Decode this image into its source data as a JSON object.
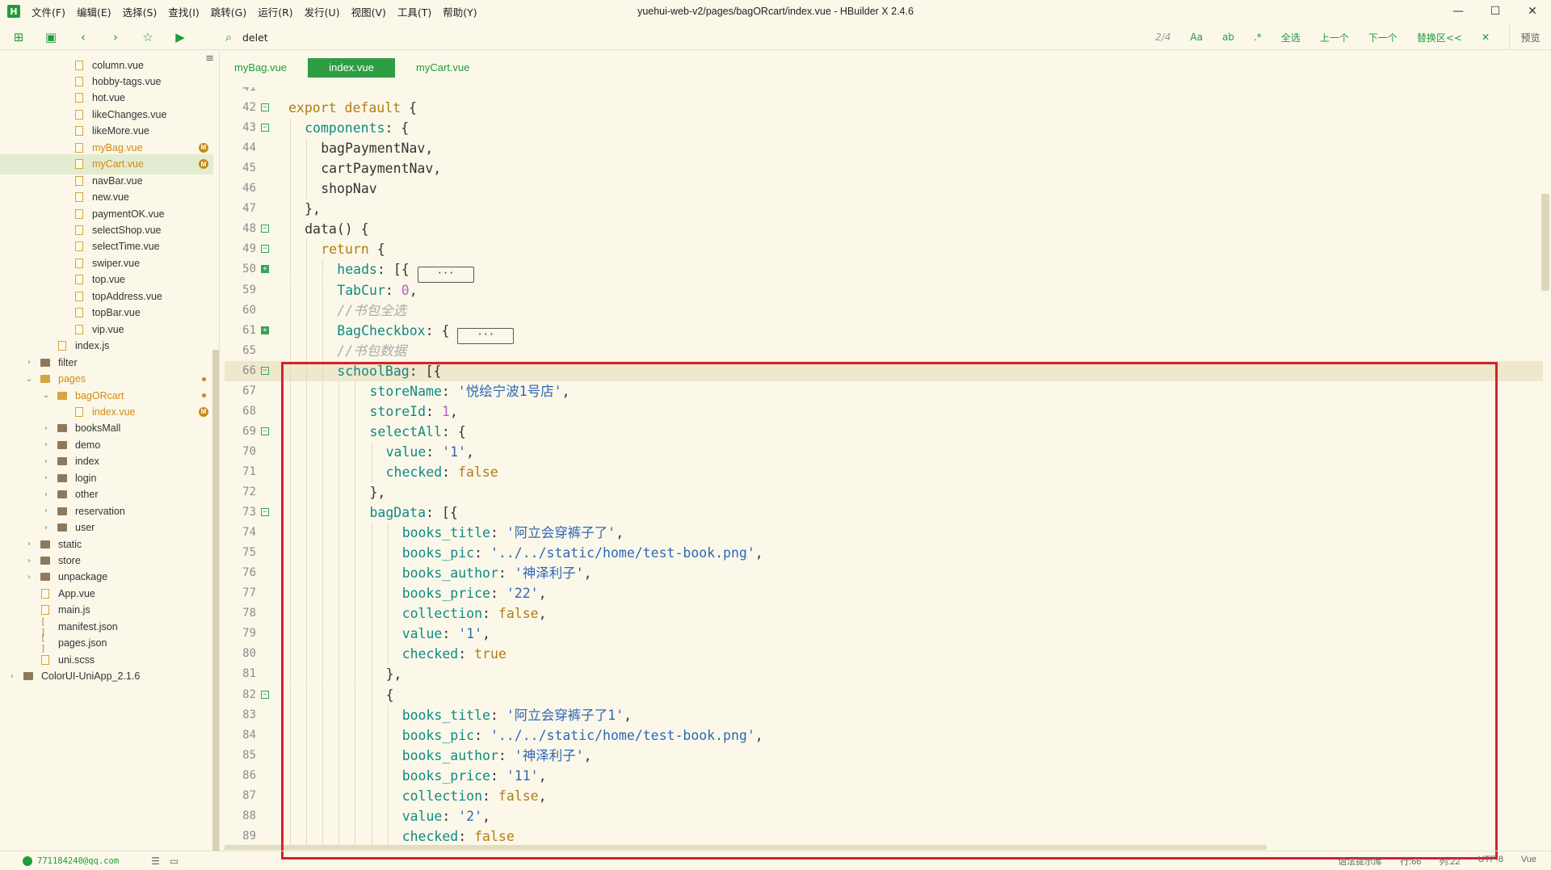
{
  "titlebar": {
    "logo": "H",
    "title": "yuehui-web-v2/pages/bagORcart/index.vue - HBuilder X 2.4.6",
    "menu": [
      "文件(F)",
      "编辑(E)",
      "选择(S)",
      "查找(I)",
      "跳转(G)",
      "运行(R)",
      "发行(U)",
      "视图(V)",
      "工具(T)",
      "帮助(Y)"
    ],
    "controls": {
      "minimize": "—",
      "maximize": "☐",
      "close": "✕"
    }
  },
  "toolbar": {
    "search_value": "delet",
    "match_count": "2/4",
    "find_options": [
      "Aa",
      "ab",
      ".*"
    ],
    "select_all": "全选",
    "prev": "上一个",
    "next": "下一个",
    "replace": "替换区<<",
    "close": "✕",
    "preview": "预览"
  },
  "sidebar": {
    "items": [
      {
        "name": "column.vue",
        "depth": 4,
        "kind": "file"
      },
      {
        "name": "hobby-tags.vue",
        "depth": 4,
        "kind": "file"
      },
      {
        "name": "hot.vue",
        "depth": 4,
        "kind": "file"
      },
      {
        "name": "likeChanges.vue",
        "depth": 4,
        "kind": "file"
      },
      {
        "name": "likeMore.vue",
        "depth": 4,
        "kind": "file"
      },
      {
        "name": "myBag.vue",
        "depth": 4,
        "kind": "file",
        "modified": true,
        "badge": "M"
      },
      {
        "name": "myCart.vue",
        "depth": 4,
        "kind": "file",
        "modified": true,
        "badge": "M",
        "selected": true
      },
      {
        "name": "navBar.vue",
        "depth": 4,
        "kind": "file"
      },
      {
        "name": "new.vue",
        "depth": 4,
        "kind": "file"
      },
      {
        "name": "paymentOK.vue",
        "depth": 4,
        "kind": "file"
      },
      {
        "name": "selectShop.vue",
        "depth": 4,
        "kind": "file"
      },
      {
        "name": "selectTime.vue",
        "depth": 4,
        "kind": "file"
      },
      {
        "name": "swiper.vue",
        "depth": 4,
        "kind": "file"
      },
      {
        "name": "top.vue",
        "depth": 4,
        "kind": "file"
      },
      {
        "name": "topAddress.vue",
        "depth": 4,
        "kind": "file"
      },
      {
        "name": "topBar.vue",
        "depth": 4,
        "kind": "file"
      },
      {
        "name": "vip.vue",
        "depth": 4,
        "kind": "file"
      },
      {
        "name": "index.js",
        "depth": 3,
        "kind": "file"
      },
      {
        "name": "filter",
        "depth": 2,
        "kind": "folder",
        "chev": "›"
      },
      {
        "name": "pages",
        "depth": 2,
        "kind": "folder-open",
        "chev": "⌄",
        "modified": true,
        "dot": true
      },
      {
        "name": "bagORcart",
        "depth": 3,
        "kind": "folder-open",
        "chev": "⌄",
        "modified": true,
        "dot": true
      },
      {
        "name": "index.vue",
        "depth": 4,
        "kind": "file",
        "modified": true,
        "badge": "M"
      },
      {
        "name": "booksMall",
        "depth": 3,
        "kind": "folder",
        "chev": "›"
      },
      {
        "name": "demo",
        "depth": 3,
        "kind": "folder",
        "chev": "›"
      },
      {
        "name": "index",
        "depth": 3,
        "kind": "folder",
        "chev": "›"
      },
      {
        "name": "login",
        "depth": 3,
        "kind": "folder",
        "chev": "›"
      },
      {
        "name": "other",
        "depth": 3,
        "kind": "folder",
        "chev": "›"
      },
      {
        "name": "reservation",
        "depth": 3,
        "kind": "folder",
        "chev": "›"
      },
      {
        "name": "user",
        "depth": 3,
        "kind": "folder",
        "chev": "›"
      },
      {
        "name": "static",
        "depth": 2,
        "kind": "folder",
        "chev": "›"
      },
      {
        "name": "store",
        "depth": 2,
        "kind": "folder",
        "chev": "›"
      },
      {
        "name": "unpackage",
        "depth": 2,
        "kind": "folder",
        "chev": "›"
      },
      {
        "name": "App.vue",
        "depth": 2,
        "kind": "file"
      },
      {
        "name": "main.js",
        "depth": 2,
        "kind": "file"
      },
      {
        "name": "manifest.json",
        "depth": 2,
        "kind": "json"
      },
      {
        "name": "pages.json",
        "depth": 2,
        "kind": "json"
      },
      {
        "name": "uni.scss",
        "depth": 2,
        "kind": "file"
      },
      {
        "name": "ColorUI-UniApp_2.1.6",
        "depth": 1,
        "kind": "folder",
        "chev": "›"
      }
    ]
  },
  "tabs": [
    {
      "label": "myBag.vue",
      "active": false
    },
    {
      "label": "index.vue",
      "active": true
    },
    {
      "label": "myCart.vue",
      "active": false
    }
  ],
  "editor": {
    "ellipsis": "···",
    "lines": [
      {
        "n": "41",
        "indent": 0,
        "tokens": []
      },
      {
        "n": "42",
        "indent": 0,
        "fold": "open",
        "tokens": [
          [
            "kw",
            "export default"
          ],
          [
            "plain",
            " {"
          ]
        ]
      },
      {
        "n": "43",
        "indent": 1,
        "fold": "open",
        "tokens": [
          [
            "prop",
            "components"
          ],
          [
            "plain",
            ": {"
          ]
        ]
      },
      {
        "n": "44",
        "indent": 2,
        "tokens": [
          [
            "plain",
            "bagPaymentNav,"
          ]
        ]
      },
      {
        "n": "45",
        "indent": 2,
        "tokens": [
          [
            "plain",
            "cartPaymentNav,"
          ]
        ]
      },
      {
        "n": "46",
        "indent": 2,
        "tokens": [
          [
            "plain",
            "shopNav"
          ]
        ]
      },
      {
        "n": "47",
        "indent": 1,
        "tokens": [
          [
            "plain",
            "},"
          ]
        ]
      },
      {
        "n": "48",
        "indent": 1,
        "fold": "open",
        "tokens": [
          [
            "plain",
            "data() {"
          ]
        ]
      },
      {
        "n": "49",
        "indent": 2,
        "fold": "open",
        "tokens": [
          [
            "kw",
            "return"
          ],
          [
            "plain",
            " {"
          ]
        ]
      },
      {
        "n": "50",
        "indent": 3,
        "fold": "collapsed",
        "tokens": [
          [
            "prop",
            "heads"
          ],
          [
            "plain",
            ": [{ "
          ],
          [
            "box",
            ""
          ]
        ]
      },
      {
        "n": "59",
        "indent": 3,
        "tokens": [
          [
            "prop",
            "TabCur"
          ],
          [
            "plain",
            ": "
          ],
          [
            "num",
            "0"
          ],
          [
            "plain",
            ","
          ]
        ]
      },
      {
        "n": "60",
        "indent": 3,
        "tokens": [
          [
            "cm",
            "//书包全选"
          ]
        ]
      },
      {
        "n": "61",
        "indent": 3,
        "fold": "collapsed",
        "tokens": [
          [
            "prop",
            "BagCheckbox"
          ],
          [
            "plain",
            ": { "
          ],
          [
            "box",
            ""
          ]
        ]
      },
      {
        "n": "65",
        "indent": 3,
        "tokens": [
          [
            "cm",
            "//书包数据"
          ]
        ]
      },
      {
        "n": "66",
        "indent": 3,
        "fold": "open",
        "current": true,
        "tokens": [
          [
            "prop",
            "schoolBag"
          ],
          [
            "plain",
            ": [{"
          ]
        ]
      },
      {
        "n": "67",
        "indent": 5,
        "tokens": [
          [
            "prop",
            "storeName"
          ],
          [
            "plain",
            ": "
          ],
          [
            "str",
            "'悦绘宁波1号店'"
          ],
          [
            "plain",
            ","
          ]
        ]
      },
      {
        "n": "68",
        "indent": 5,
        "tokens": [
          [
            "prop",
            "storeId"
          ],
          [
            "plain",
            ": "
          ],
          [
            "num",
            "1"
          ],
          [
            "plain",
            ","
          ]
        ]
      },
      {
        "n": "69",
        "indent": 5,
        "fold": "open",
        "tokens": [
          [
            "prop",
            "selectAll"
          ],
          [
            "plain",
            ": {"
          ]
        ]
      },
      {
        "n": "70",
        "indent": 6,
        "tokens": [
          [
            "prop",
            "value"
          ],
          [
            "plain",
            ": "
          ],
          [
            "str",
            "'1'"
          ],
          [
            "plain",
            ","
          ]
        ]
      },
      {
        "n": "71",
        "indent": 6,
        "tokens": [
          [
            "prop",
            "checked"
          ],
          [
            "plain",
            ": "
          ],
          [
            "bool",
            "false"
          ]
        ]
      },
      {
        "n": "72",
        "indent": 5,
        "tokens": [
          [
            "plain",
            "},"
          ]
        ]
      },
      {
        "n": "73",
        "indent": 5,
        "fold": "open",
        "tokens": [
          [
            "prop",
            "bagData"
          ],
          [
            "plain",
            ": [{"
          ]
        ]
      },
      {
        "n": "74",
        "indent": 7,
        "tokens": [
          [
            "prop",
            "books_title"
          ],
          [
            "plain",
            ": "
          ],
          [
            "str",
            "'阿立会穿裤子了'"
          ],
          [
            "plain",
            ","
          ]
        ]
      },
      {
        "n": "75",
        "indent": 7,
        "tokens": [
          [
            "prop",
            "books_pic"
          ],
          [
            "plain",
            ": "
          ],
          [
            "str",
            "'../../static/home/test-book.png'"
          ],
          [
            "plain",
            ","
          ]
        ]
      },
      {
        "n": "76",
        "indent": 7,
        "tokens": [
          [
            "prop",
            "books_author"
          ],
          [
            "plain",
            ": "
          ],
          [
            "str",
            "'神泽利子'"
          ],
          [
            "plain",
            ","
          ]
        ]
      },
      {
        "n": "77",
        "indent": 7,
        "tokens": [
          [
            "prop",
            "books_price"
          ],
          [
            "plain",
            ": "
          ],
          [
            "str",
            "'22'"
          ],
          [
            "plain",
            ","
          ]
        ]
      },
      {
        "n": "78",
        "indent": 7,
        "tokens": [
          [
            "prop",
            "collection"
          ],
          [
            "plain",
            ": "
          ],
          [
            "bool",
            "false"
          ],
          [
            "plain",
            ","
          ]
        ]
      },
      {
        "n": "79",
        "indent": 7,
        "tokens": [
          [
            "prop",
            "value"
          ],
          [
            "plain",
            ": "
          ],
          [
            "str",
            "'1'"
          ],
          [
            "plain",
            ","
          ]
        ]
      },
      {
        "n": "80",
        "indent": 7,
        "tokens": [
          [
            "prop",
            "checked"
          ],
          [
            "plain",
            ": "
          ],
          [
            "bool",
            "true"
          ]
        ]
      },
      {
        "n": "81",
        "indent": 6,
        "tokens": [
          [
            "plain",
            "},"
          ]
        ]
      },
      {
        "n": "82",
        "indent": 6,
        "fold": "open",
        "tokens": [
          [
            "plain",
            "{"
          ]
        ]
      },
      {
        "n": "83",
        "indent": 7,
        "tokens": [
          [
            "prop",
            "books_title"
          ],
          [
            "plain",
            ": "
          ],
          [
            "str",
            "'阿立会穿裤子了1'"
          ],
          [
            "plain",
            ","
          ]
        ]
      },
      {
        "n": "84",
        "indent": 7,
        "tokens": [
          [
            "prop",
            "books_pic"
          ],
          [
            "plain",
            ": "
          ],
          [
            "str",
            "'../../static/home/test-book.png'"
          ],
          [
            "plain",
            ","
          ]
        ]
      },
      {
        "n": "85",
        "indent": 7,
        "tokens": [
          [
            "prop",
            "books_author"
          ],
          [
            "plain",
            ": "
          ],
          [
            "str",
            "'神泽利子'"
          ],
          [
            "plain",
            ","
          ]
        ]
      },
      {
        "n": "86",
        "indent": 7,
        "tokens": [
          [
            "prop",
            "books_price"
          ],
          [
            "plain",
            ": "
          ],
          [
            "str",
            "'11'"
          ],
          [
            "plain",
            ","
          ]
        ]
      },
      {
        "n": "87",
        "indent": 7,
        "tokens": [
          [
            "prop",
            "collection"
          ],
          [
            "plain",
            ": "
          ],
          [
            "bool",
            "false"
          ],
          [
            "plain",
            ","
          ]
        ]
      },
      {
        "n": "88",
        "indent": 7,
        "tokens": [
          [
            "prop",
            "value"
          ],
          [
            "plain",
            ": "
          ],
          [
            "str",
            "'2'"
          ],
          [
            "plain",
            ","
          ]
        ]
      },
      {
        "n": "89",
        "indent": 7,
        "tokens": [
          [
            "prop",
            "checked"
          ],
          [
            "plain",
            ": "
          ],
          [
            "bool",
            "false"
          ]
        ]
      }
    ]
  },
  "statusbar": {
    "email": "771184240@qq.com",
    "right": [
      "语法提示库",
      "行:66",
      "列:22",
      "UTF-8",
      "Vue"
    ]
  },
  "colors": {
    "accent": "#1f9d3b",
    "background": "#fbf8ea",
    "highlight_border": "#d3222b",
    "modified": "#d08a10"
  }
}
